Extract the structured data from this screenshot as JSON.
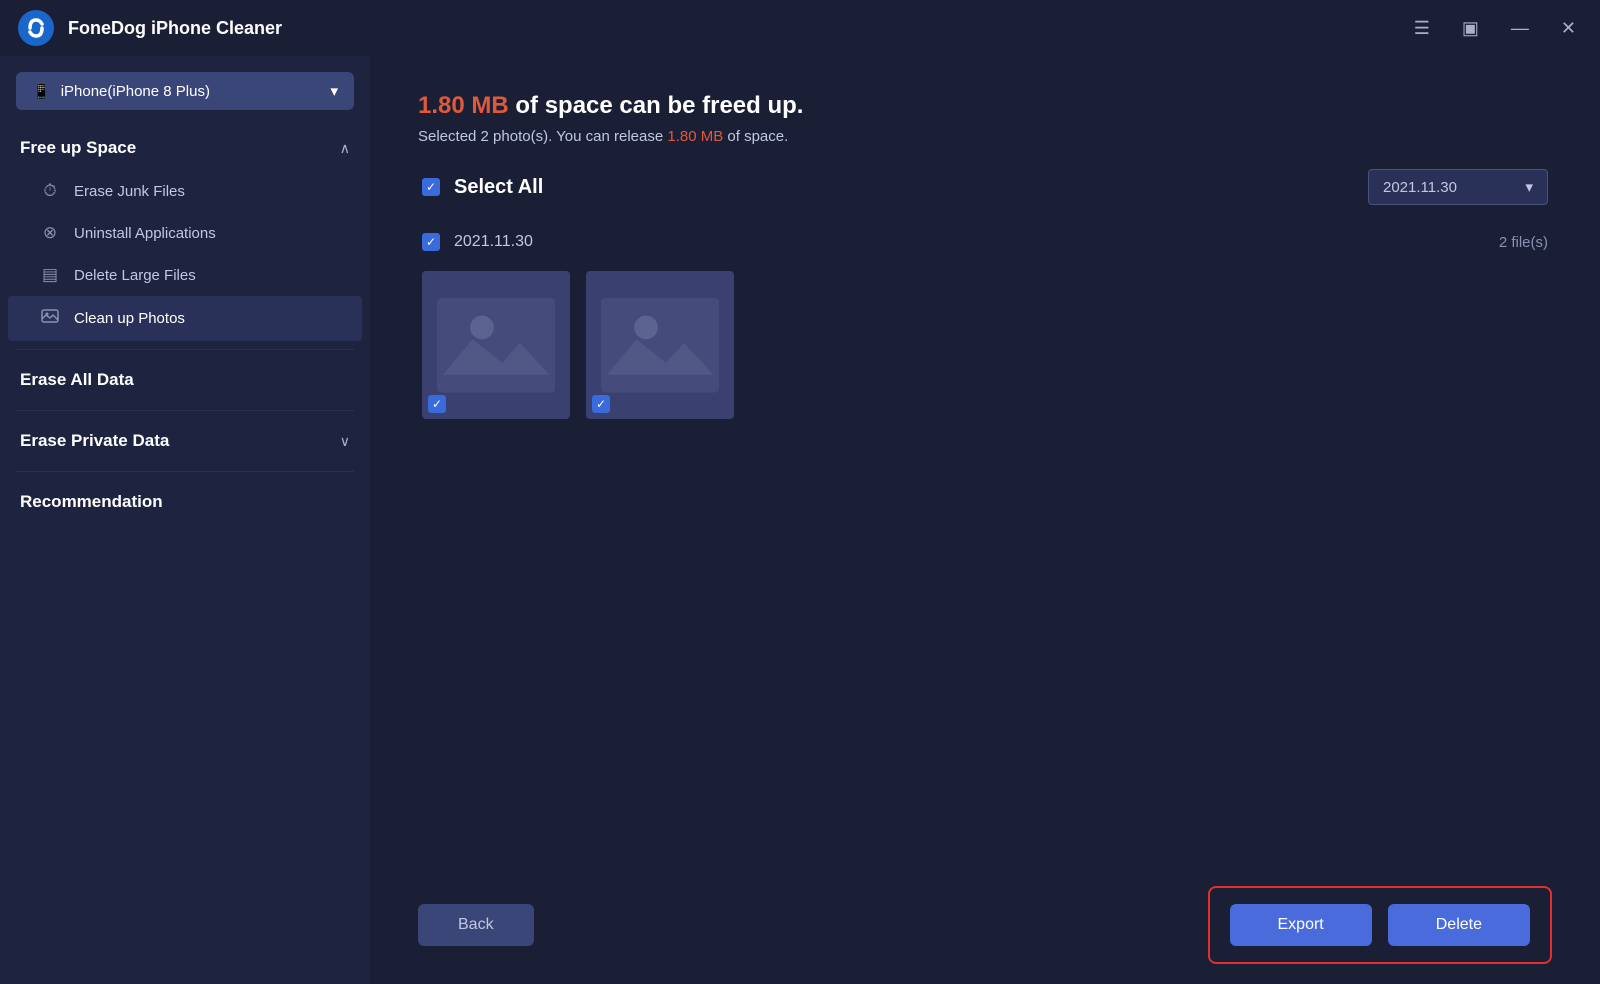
{
  "app": {
    "title": "FoneDog iPhone Cleaner",
    "logo_text": "C"
  },
  "title_bar": {
    "menu_icon": "☰",
    "chat_icon": "▣",
    "minimize_icon": "—",
    "close_icon": "✕"
  },
  "device": {
    "name": "iPhone(iPhone 8 Plus)",
    "icon": "📱"
  },
  "sidebar": {
    "free_up_space": {
      "label": "Free up Space",
      "expanded": true,
      "items": [
        {
          "id": "erase-junk",
          "label": "Erase Junk Files",
          "icon": "⏱"
        },
        {
          "id": "uninstall-apps",
          "label": "Uninstall Applications",
          "icon": "⊗"
        },
        {
          "id": "delete-large",
          "label": "Delete Large Files",
          "icon": "▤"
        },
        {
          "id": "clean-photos",
          "label": "Clean up Photos",
          "icon": "🖼",
          "active": true
        }
      ]
    },
    "erase_all_data": {
      "label": "Erase All Data"
    },
    "erase_private_data": {
      "label": "Erase Private Data"
    },
    "recommendation": {
      "label": "Recommendation"
    }
  },
  "content": {
    "space_amount": "1.80 MB",
    "space_title_suffix": " of space can be freed up.",
    "subtitle_prefix": "Selected ",
    "subtitle_count": "2",
    "subtitle_middle": " photo(s). You can release ",
    "subtitle_amount": "1.80 MB",
    "subtitle_suffix": " of space.",
    "select_all_label": "Select All",
    "date_group": {
      "date": "2021.11.30",
      "count": "2 file(s)"
    },
    "date_filter": "2021.11.30"
  },
  "buttons": {
    "back": "Back",
    "export": "Export",
    "delete": "Delete"
  }
}
